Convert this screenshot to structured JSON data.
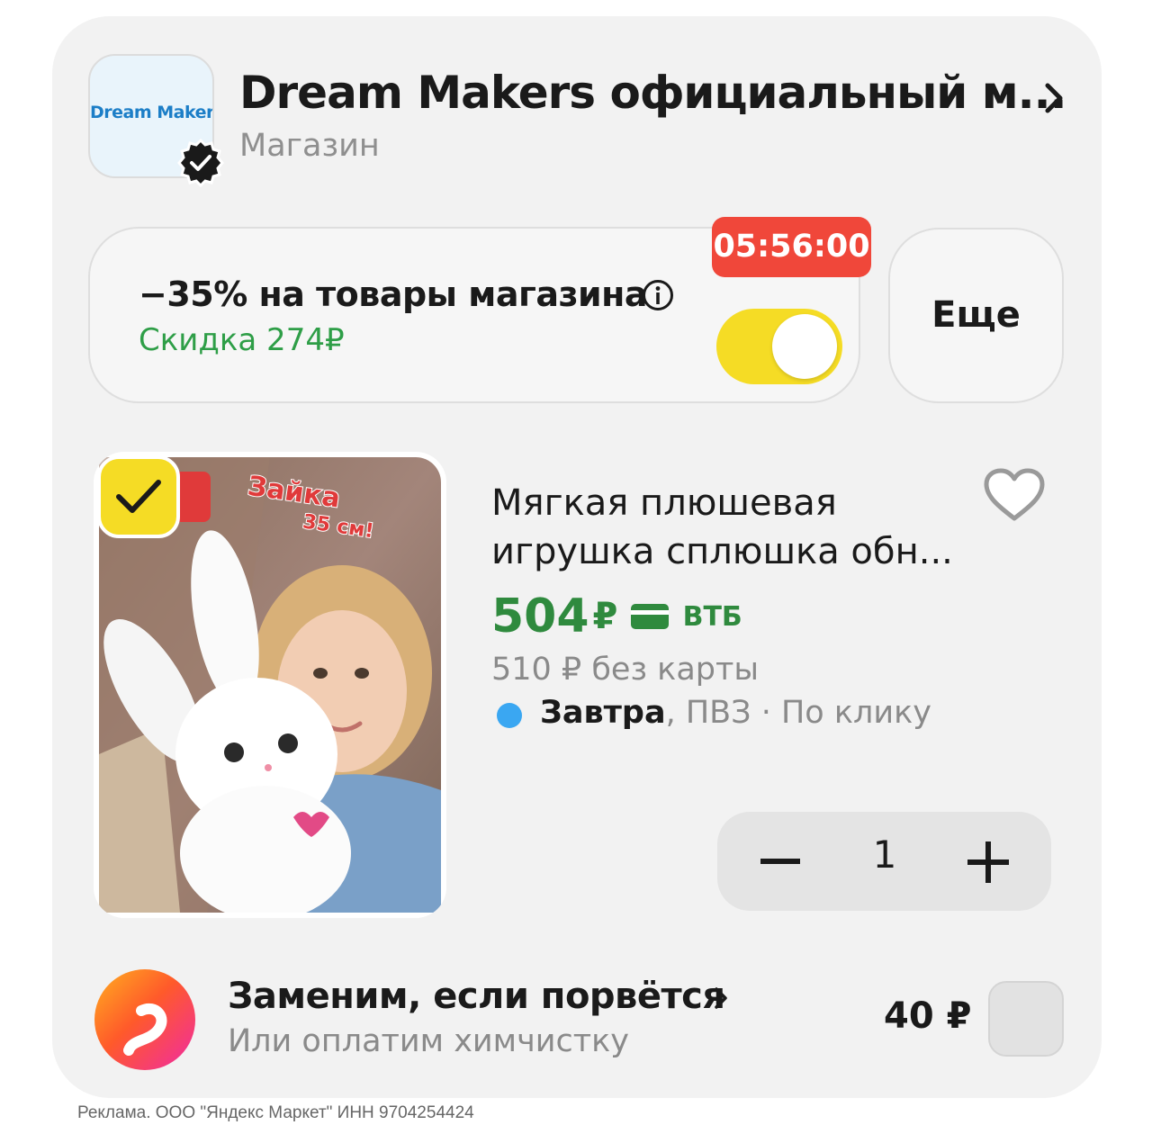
{
  "shop": {
    "logo_text": "Dream Makers",
    "name": "Dream Makers официальный м...",
    "type": "Магазин",
    "verified_icon": "verified-badge-icon",
    "chevron_icon": "chevron-right-icon"
  },
  "promo": {
    "title": "−35% на товары магазина",
    "subtitle": "Скидка 274₽",
    "timer": "05:56:00",
    "toggle_on": true,
    "info_icon": "info-icon",
    "more_label": "Еще"
  },
  "product": {
    "badge_text": "Зайка",
    "badge_size": "35 см!",
    "title": "Мягкая плюшевая игрушка сплюшка обн...",
    "price": "504",
    "currency": "₽",
    "payment_icon": "bank-card-icon",
    "bank": "ВТБ",
    "old_price": "510 ₽  без карты",
    "delivery_day": "Завтра",
    "delivery_rest": ", ПВЗ · По клику",
    "quantity": "1",
    "selected": true
  },
  "insurance": {
    "title": "Заменим, если порвётся",
    "subtitle": "Или оплатим химчистку",
    "price": "40 ₽",
    "checked": false
  },
  "footer": {
    "text": "Реклама. ООО \"Яндекс Маркет\" ИНН 9704254424"
  },
  "colors": {
    "accent_yellow": "#f5dc25",
    "price_green": "#2f8a3e",
    "timer_red": "#f0473a",
    "delivery_blue": "#3aa7f2"
  }
}
